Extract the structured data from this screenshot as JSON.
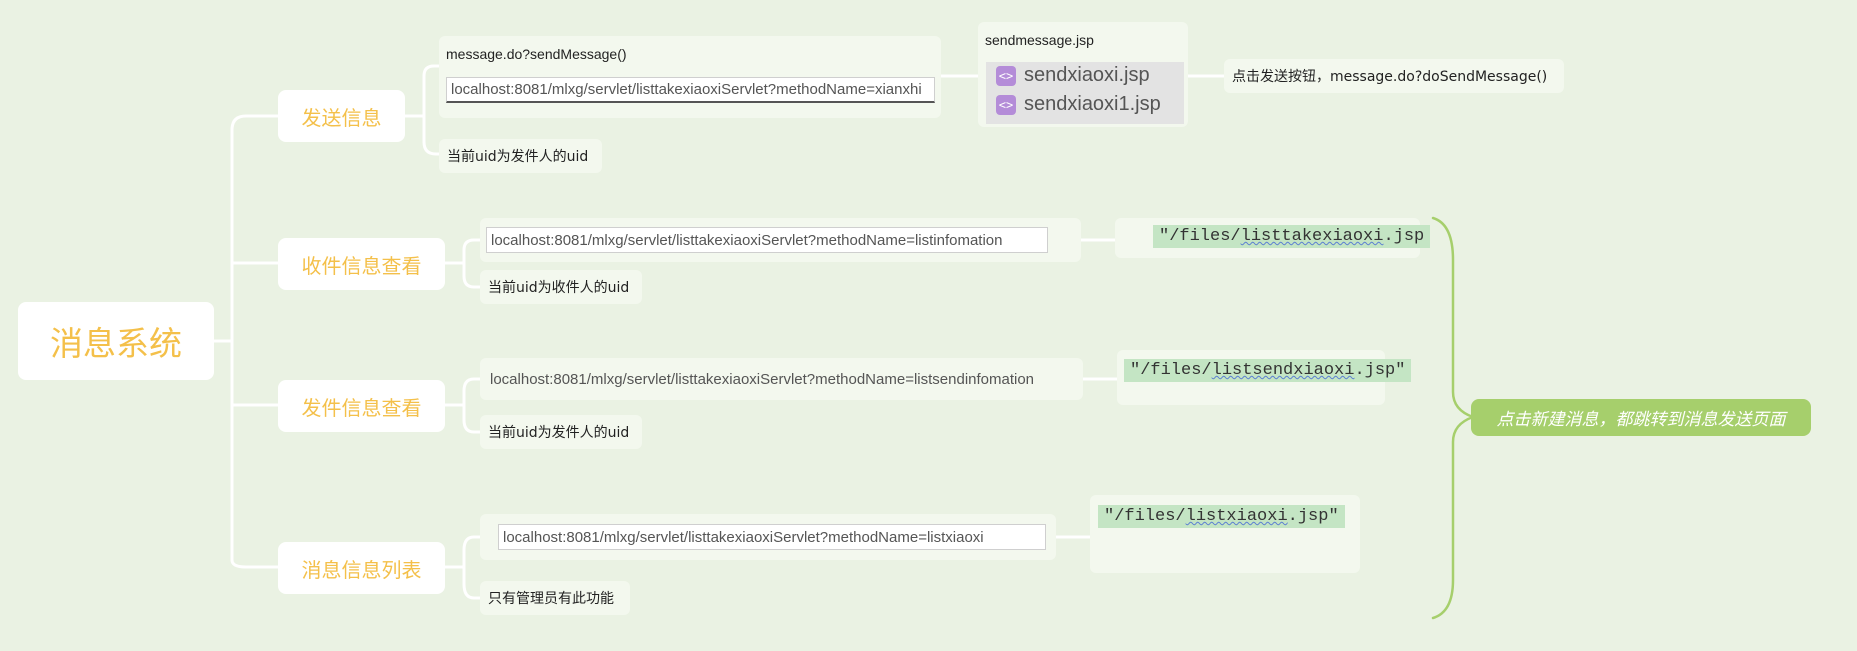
{
  "root": {
    "label": "消息系统"
  },
  "branches": [
    {
      "label": "发送信息",
      "endpoint_caption": "message.do?sendMessage()",
      "url": "localhost:8081/mlxg/servlet/listtakexiaoxiServlet?methodName=xianxhi",
      "note": "当前uid为发件人的uid",
      "page_caption": "sendmessage.jsp",
      "files": [
        "sendxiaoxi.jsp",
        "sendxiaoxi1.jsp"
      ],
      "action_note": "点击发送按钮，message.do?doSendMessage()"
    },
    {
      "label": "收件信息查看",
      "url": "localhost:8081/mlxg/servlet/listtakexiaoxiServlet?methodName=listinfomation",
      "note": "当前uid为收件人的uid",
      "code_prefix": "\"/files/",
      "code_word": "listtakexiaoxi",
      "code_suffix": ".jsp"
    },
    {
      "label": "发件信息查看",
      "url": "localhost:8081/mlxg/servlet/listtakexiaoxiServlet?methodName=listsendinfomation",
      "note": "当前uid为发件人的uid",
      "code_prefix": "\"/files/",
      "code_word": "listsendxiaoxi",
      "code_suffix": ".jsp\""
    },
    {
      "label": "消息信息列表",
      "url": "localhost:8081/mlxg/servlet/listtakexiaoxiServlet?methodName=listxiaoxi",
      "note": "只有管理员有此功能",
      "code_prefix": "\"/files/",
      "code_word": "listxiaoxi",
      "code_suffix": ".jsp\""
    }
  ],
  "summary": {
    "label": "点击新建消息，都跳转到消息发送页面"
  },
  "colors": {
    "background": "#eaf2e3",
    "connector": "#ffffff",
    "brace": "#a6cf6c",
    "topic_text": "#f4c04a",
    "summary_fill": "#a6cf6c"
  }
}
